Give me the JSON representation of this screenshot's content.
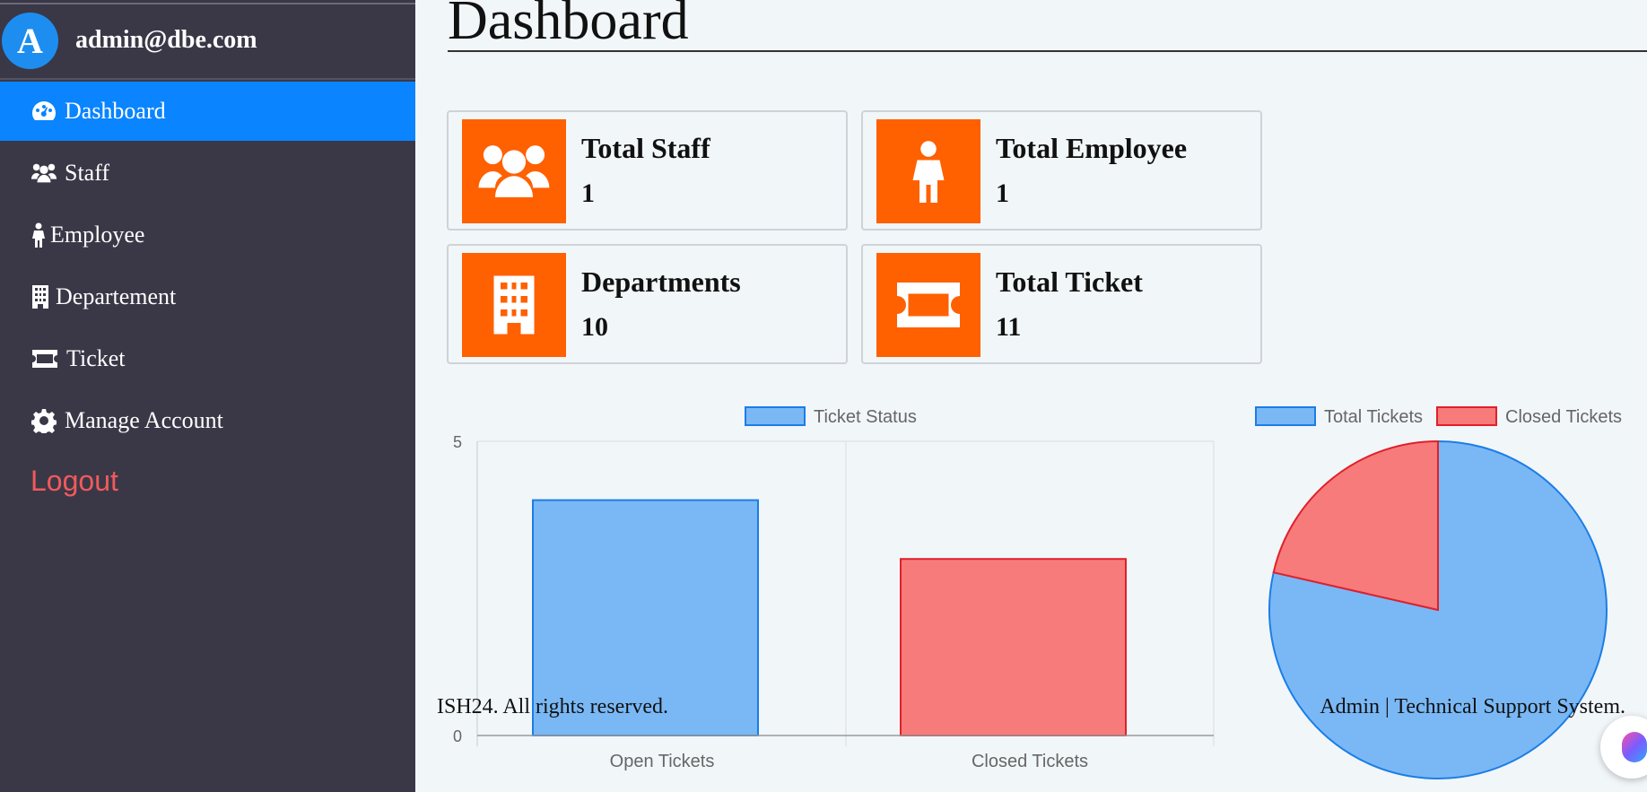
{
  "sidebar": {
    "avatar_letter": "A",
    "email": "admin@dbe.com",
    "items": [
      {
        "label": "Dashboard",
        "icon": "gauge-icon"
      },
      {
        "label": "Staff",
        "icon": "users-icon"
      },
      {
        "label": "Employee",
        "icon": "person-icon"
      },
      {
        "label": "Departement",
        "icon": "building-icon"
      },
      {
        "label": "Ticket",
        "icon": "ticket-icon"
      },
      {
        "label": "Manage Account",
        "icon": "gear-icon"
      }
    ],
    "logout": "Logout",
    "colors": {
      "background": "#3a3847",
      "active": "#0a84ff",
      "logout": "#f25a5a"
    }
  },
  "main": {
    "title": "Dashboard",
    "cards": [
      {
        "label": "Total Staff",
        "value": "1",
        "icon": "users-icon"
      },
      {
        "label": "Total Employee",
        "value": "1",
        "icon": "person-icon"
      },
      {
        "label": "Departments",
        "value": "10",
        "icon": "building-icon"
      },
      {
        "label": "Total Ticket",
        "value": "11",
        "icon": "ticket-icon"
      }
    ],
    "tile_color": "#ff6000"
  },
  "chart_data": [
    {
      "type": "bar",
      "legend": [
        "Ticket Status"
      ],
      "categories": [
        "Open Tickets",
        "Closed Tickets"
      ],
      "series": [
        {
          "name": "Ticket Status",
          "values": [
            4,
            3
          ]
        }
      ],
      "ylim": [
        0,
        5
      ],
      "yticks": [
        "5",
        "0"
      ],
      "colors": [
        "#7ab8f5",
        "#f77b7b"
      ],
      "border_colors": [
        "#1c7de6",
        "#e0202a"
      ],
      "grid": true,
      "legend_position": "top"
    },
    {
      "type": "pie",
      "legend": [
        "Total Tickets",
        "Closed Tickets"
      ],
      "values": [
        11,
        3
      ],
      "colors": [
        "#7ab8f5",
        "#f77b7b"
      ],
      "border_colors": [
        "#1c7de6",
        "#e0202a"
      ],
      "legend_position": "top"
    }
  ],
  "footer": {
    "left": "ISH24. All rights reserved.",
    "right": "Admin | Technical Support System."
  }
}
